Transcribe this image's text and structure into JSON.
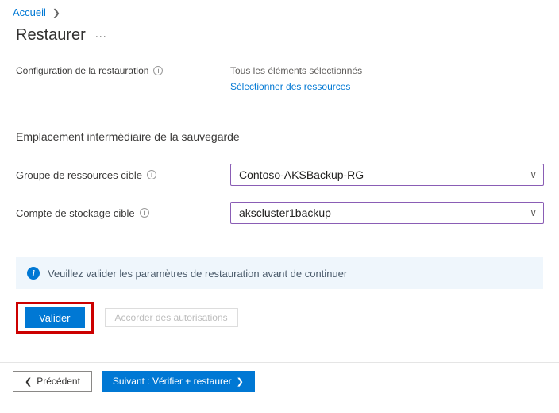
{
  "breadcrumb": {
    "home": "Accueil"
  },
  "page": {
    "title": "Restaurer"
  },
  "config": {
    "label": "Configuration de la restauration",
    "selected_text": "Tous les éléments sélectionnés",
    "link_text": "Sélectionner des ressources"
  },
  "staging": {
    "heading": "Emplacement intermédiaire de la sauvegarde",
    "resource_group_label": "Groupe de ressources cible",
    "resource_group_value": "Contoso-AKSBackup-RG",
    "storage_account_label": "Compte de stockage cible",
    "storage_account_value": "akscluster1backup"
  },
  "alert": {
    "message": "Veuillez valider les paramètres de restauration avant de continuer"
  },
  "buttons": {
    "validate": "Valider",
    "grant_permissions": "Accorder des autorisations",
    "previous": "Précédent",
    "next": "Suivant : Vérifier +  restaurer"
  }
}
